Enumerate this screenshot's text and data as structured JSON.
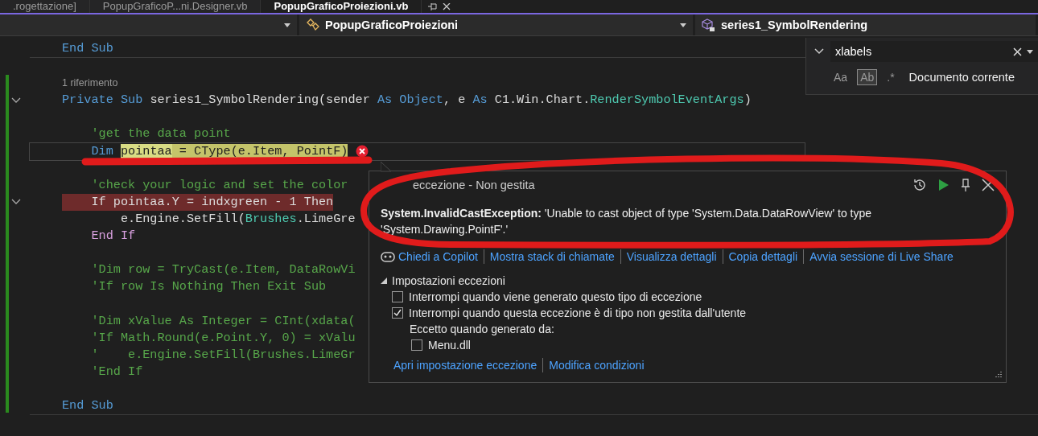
{
  "tabs": [
    {
      "label": ".rogettazione]",
      "selected": false
    },
    {
      "label": "PopupGraficoP...ni.Designer.vb",
      "selected": false
    },
    {
      "label": "PopupGraficoProiezioni.vb",
      "selected": true
    }
  ],
  "nav": {
    "class_dropdown": "PopupGraficoProiezioni",
    "member_dropdown": "series1_SymbolRendering"
  },
  "find": {
    "value": "xlabels",
    "options": [
      {
        "label": "Aa",
        "selected": false
      },
      {
        "label": "Ab",
        "selected": true
      },
      {
        "label": ".*",
        "selected": false
      }
    ],
    "scope": "Documento corrente"
  },
  "lines": [
    {
      "kind": "code",
      "separator_after": true,
      "tokens": [
        {
          "kind": "kw",
          "text": "End Sub"
        }
      ]
    },
    {
      "kind": "blank"
    },
    {
      "kind": "codelens",
      "text": "1 riferimento"
    },
    {
      "kind": "code",
      "fold": true,
      "tokens": [
        {
          "kind": "kw",
          "text": "Private Sub "
        },
        {
          "kind": "id",
          "text": "series1_SymbolRendering(sender "
        },
        {
          "kind": "kw",
          "text": "As Object"
        },
        {
          "kind": "id",
          "text": ", e "
        },
        {
          "kind": "kw",
          "text": "As "
        },
        {
          "kind": "id",
          "text": "C1.Win.Chart."
        },
        {
          "kind": "type",
          "text": "RenderSymbolEventArgs"
        },
        {
          "kind": "id",
          "text": ")"
        }
      ]
    },
    {
      "kind": "blank"
    },
    {
      "kind": "code",
      "tokens": [
        {
          "kind": "cmt",
          "text": "    'get the data point"
        }
      ]
    },
    {
      "kind": "code",
      "current": true,
      "error": true,
      "tokens": [
        {
          "kind": "kw",
          "text": "    Dim "
        },
        {
          "kind": "hl",
          "text": "pointaa"
        },
        {
          "kind": "hl2",
          "text": " = CType(e.Item, PointF)"
        }
      ]
    },
    {
      "kind": "blank"
    },
    {
      "kind": "code",
      "tokens": [
        {
          "kind": "cmt",
          "text": "    'check your logic and set the color"
        }
      ]
    },
    {
      "kind": "code",
      "fold": true,
      "marked": true,
      "tokens": [
        {
          "kind": "id",
          "text": "    If pointaa.Y = indxgreen - 1 Then"
        }
      ]
    },
    {
      "kind": "code",
      "tokens": [
        {
          "kind": "id",
          "text": "        e.Engine.SetFill("
        },
        {
          "kind": "type",
          "text": "Brushes"
        },
        {
          "kind": "id",
          "text": ".LimeGre"
        }
      ]
    },
    {
      "kind": "code",
      "tokens": [
        {
          "kind": "ctl",
          "text": "    End If"
        }
      ]
    },
    {
      "kind": "blank"
    },
    {
      "kind": "code",
      "tokens": [
        {
          "kind": "cmt",
          "text": "    'Dim row = TryCast(e.Item, DataRowVi"
        }
      ]
    },
    {
      "kind": "code",
      "tokens": [
        {
          "kind": "cmt",
          "text": "    'If row Is Nothing Then Exit Sub"
        }
      ]
    },
    {
      "kind": "blank"
    },
    {
      "kind": "code",
      "tokens": [
        {
          "kind": "cmt",
          "text": "    'Dim xValue As Integer = CInt(xdata("
        }
      ]
    },
    {
      "kind": "code",
      "tokens": [
        {
          "kind": "cmt",
          "text": "    'If Math.Round(e.Point.Y, 0) = xValu"
        }
      ]
    },
    {
      "kind": "code",
      "tokens": [
        {
          "kind": "cmt",
          "text": "    '    e.Engine.SetFill(Brushes.LimeGr"
        }
      ]
    },
    {
      "kind": "code",
      "tokens": [
        {
          "kind": "cmt",
          "text": "    'End If"
        }
      ]
    },
    {
      "kind": "blank"
    },
    {
      "kind": "code",
      "separator_after": true,
      "tokens": [
        {
          "kind": "kw",
          "text": "End Sub"
        }
      ]
    }
  ],
  "exception": {
    "title": "eccezione - Non gestita",
    "message": "**System.InvalidCastException:** 'Unable to cast object of type 'System.Data.DataRowView' to type 'System.Drawing.PointF'.'",
    "actions": [
      "Chiedi a Copilot",
      "Mostra stack di chiamate",
      "Visualizza dettagli",
      "Copia dettagli",
      "Avvia sessione di Live Share"
    ],
    "settings": {
      "title": "Impostazioni eccezioni",
      "expanded": true,
      "options": [
        {
          "label": "Interrompi quando viene generato questo tipo di eccezione",
          "checked": false
        },
        {
          "label": "Interrompi quando questa eccezione è di tipo non gestita dall'utente",
          "checked": true
        }
      ],
      "except_label": "Eccetto quando generato da:",
      "modules": [
        {
          "label": "Menu.dll",
          "checked": false
        }
      ]
    },
    "links": [
      "Apri impostazione eccezione",
      "Modifica condizioni"
    ]
  }
}
